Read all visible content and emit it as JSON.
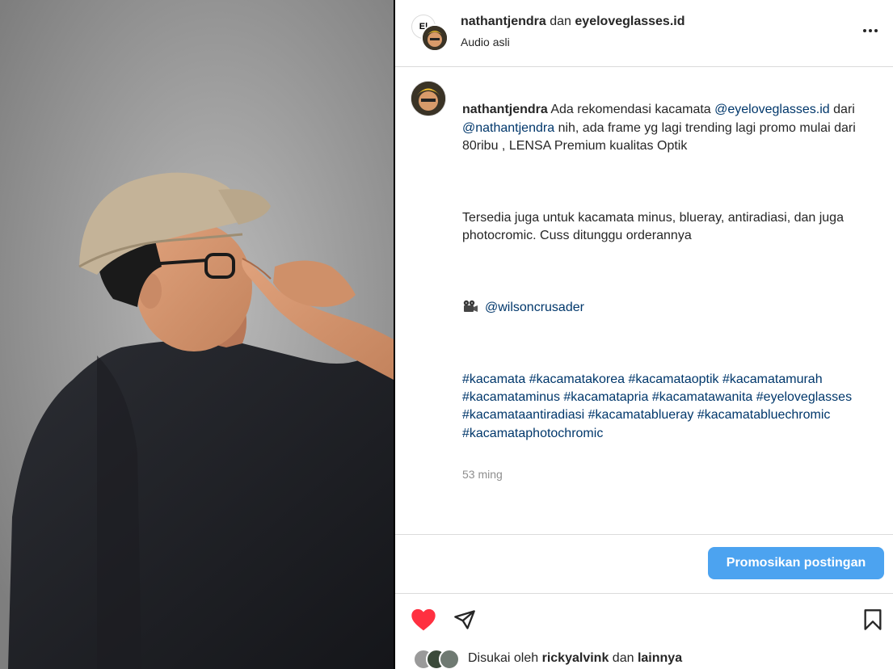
{
  "header": {
    "user1": "nathantjendra",
    "conjunction": "dan",
    "user2": "eyeloveglasses.id",
    "subtitle": "Audio asli",
    "more_icon": "more-horizontal-icon"
  },
  "caption": {
    "username": "nathantjendra",
    "text_a": "Ada rekomendasi kacamata",
    "mention_brand": "@eyeloveglasses.id",
    "text_b": "dari",
    "mention_user": "@nathantjendra",
    "text_c": "nih, ada frame yg lagi trending lagi promo mulai dari 80ribu , LENSA Premium kualitas Optik",
    "para2": "Tersedia juga untuk kacamata minus, blueray, antiradiasi, dan juga photocromic. Cuss ditunggu orderannya",
    "camera_icon": "movie-camera-icon",
    "credit": "@wilsoncrusader",
    "hashtags": [
      "#kacamata",
      "#kacamatakorea",
      "#kacamataoptik",
      "#kacamatamurah",
      "#kacamataminus",
      "#kacamatapria",
      "#kacamatawanita",
      "#eyeloveglasses",
      "#kacamataantiradiasi",
      "#kacamatablueray",
      "#kacamatabluechromic",
      "#kacamataphotochromic"
    ],
    "time": "53 ming"
  },
  "promo": {
    "button_label": "Promosikan postingan"
  },
  "actions": {
    "like_icon": "heart-filled-icon",
    "share_icon": "paper-plane-icon",
    "save_icon": "bookmark-icon",
    "like_color": "#ff3040"
  },
  "likes": {
    "prefix": "Disukai oleh",
    "user": "rickyalvink",
    "conj": "dan",
    "others": "lainnya"
  },
  "colors": {
    "link": "#00376b",
    "button": "#4ca3f0",
    "border": "#dbdbdb",
    "muted": "#8e8e8e"
  }
}
